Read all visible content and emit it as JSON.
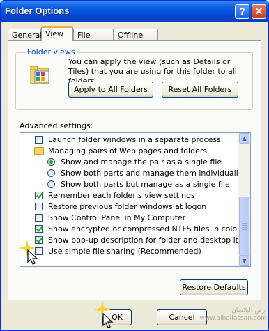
{
  "window": {
    "title": "Folder Options"
  },
  "titlebar": {
    "help_glyph": "?",
    "close_glyph": "✕",
    "help_icon": "help-icon",
    "close_icon": "close-icon"
  },
  "tabs": [
    {
      "label": "General"
    },
    {
      "label": "View",
      "active": true
    },
    {
      "label": "File Types"
    },
    {
      "label": "Offline Files"
    }
  ],
  "folder_views": {
    "legend": "Folder views",
    "description": "You can apply the view (such as Details or Tiles) that you are using for this folder to all folders.",
    "apply_button": "Apply to All Folders",
    "reset_button": "Reset All Folders"
  },
  "advanced": {
    "label": "Advanced settings:",
    "items": [
      {
        "type": "checkbox",
        "label": "Launch folder windows in a separate process",
        "checked": false
      },
      {
        "type": "folder",
        "label": "Managing pairs of Web pages and folders"
      },
      {
        "type": "radio",
        "label": "Show and manage the pair as a single file",
        "checked": true
      },
      {
        "type": "radio",
        "label": "Show both parts and manage them individually",
        "checked": false
      },
      {
        "type": "radio",
        "label": "Show both parts but manage as a single file",
        "checked": false
      },
      {
        "type": "checkbox",
        "label": "Remember each folder's view settings",
        "checked": true
      },
      {
        "type": "checkbox",
        "label": "Restore previous folder windows at logon",
        "checked": false
      },
      {
        "type": "checkbox",
        "label": "Show Control Panel in My Computer",
        "checked": false
      },
      {
        "type": "checkbox",
        "label": "Show encrypted or compressed NTFS files in color",
        "checked": true
      },
      {
        "type": "checkbox",
        "label": "Show pop-up description for folder and desktop items",
        "checked": true
      },
      {
        "type": "checkbox",
        "label": "Use simple file sharing (Recommended)",
        "checked": false
      }
    ],
    "restore_button": "Restore Defaults"
  },
  "footer": {
    "ok_button": "OK",
    "cancel_button": "Cancel"
  },
  "watermark": {
    "line1": "أرض البلاسان",
    "line2": "www.albailassan.com"
  },
  "colors": {
    "title_bar": "#0348d2",
    "legend_text": "#0046d5",
    "check": "#21a121",
    "tab_highlight": "#f1b13b"
  }
}
